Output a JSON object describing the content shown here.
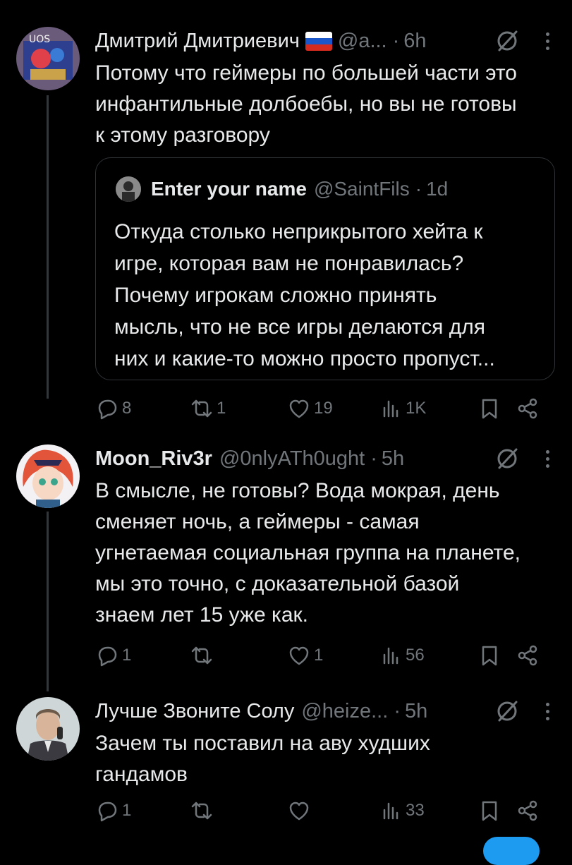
{
  "colors": {
    "background": "#000000",
    "text": "#e7e9ea",
    "muted": "#71767b",
    "border": "#2f3336",
    "accent": "#1d9bf0"
  },
  "posts": [
    {
      "name": "Дмитрий Дмитриевич",
      "flag": "🇷🇺",
      "handle": "@a...",
      "dot": "·",
      "time": "6h",
      "lines": [
        "Потому что геймеры по большей части это",
        "инфантильные долбоебы, но вы не готовы",
        "к этому разговору"
      ],
      "quote": {
        "name": "Enter your name",
        "handle": "@SaintFils",
        "dot": "·",
        "time": "1d",
        "lines": [
          "Откуда столько неприкрытого хейта к",
          "игре, которая вам не понравилась?",
          "Почему игрокам сложно принять",
          "мысль, что не все игры делаются для",
          "них и какие-то можно просто пропуст..."
        ]
      },
      "stats": {
        "replies": "8",
        "reposts": "1",
        "likes": "19",
        "views": "1K"
      }
    },
    {
      "name": "Moon_Riv3r",
      "handle": "@0nlyATh0ught",
      "dot": "·",
      "time": "5h",
      "lines": [
        "В смысле, не готовы? Вода мокрая, день",
        "сменяет ночь, а геймеры - самая",
        "угнетаемая социальная группа на планете,",
        "мы это точно, с доказательной базой",
        "знаем лет 15 уже как."
      ],
      "stats": {
        "replies": "1",
        "reposts": "",
        "likes": "1",
        "views": "56"
      }
    },
    {
      "name": "Лучше Звоните Солу",
      "handle": "@heize...",
      "dot": "·",
      "time": "5h",
      "lines": [
        "Зачем ты поставил на аву худших",
        "гандамов"
      ],
      "stats": {
        "replies": "1",
        "reposts": "",
        "likes": "",
        "views": "33"
      }
    }
  ],
  "icons": [
    "reply-icon",
    "repost-icon",
    "like-icon",
    "views-icon",
    "bookmark-icon",
    "share-icon",
    "grok-icon",
    "more-icon"
  ]
}
